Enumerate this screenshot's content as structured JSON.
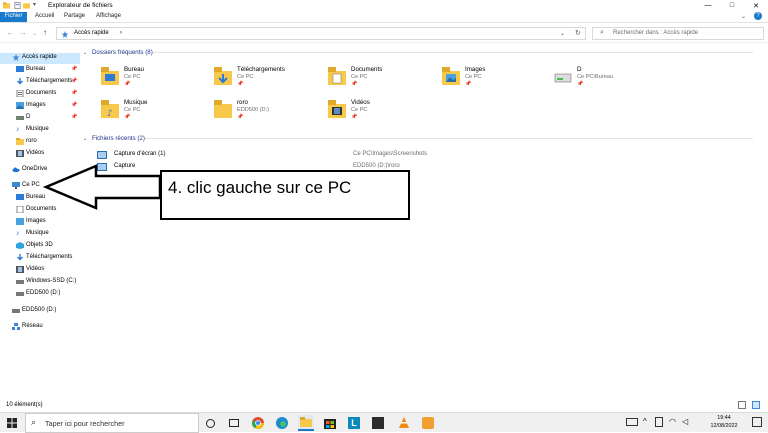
{
  "window": {
    "title": "Explorateur de fichiers",
    "controls": {
      "minimize": "—",
      "maximize": "□",
      "close": "✕"
    }
  },
  "ribbon": {
    "tabs": [
      "Fichier",
      "Accueil",
      "Partage",
      "Affichage"
    ],
    "active_color": "#1979ca"
  },
  "address_bar": {
    "crumb": "Accès rapide",
    "search_placeholder": "Rechercher dans : Accès rapide"
  },
  "sidebar": {
    "quick_access": "Accès rapide",
    "quick_items": [
      "Bureau",
      "Téléchargements",
      "Documents",
      "Images",
      "D",
      "Musique",
      "roro",
      "Vidéos"
    ],
    "onedrive": "OneDrive",
    "this_pc": "Ce PC",
    "pc_items": [
      "Bureau",
      "Documents",
      "Images",
      "Musique",
      "Objets 3D",
      "Téléchargements",
      "Vidéos",
      "Windows-SSD (C:)",
      "EDD500 (D:)"
    ],
    "drive": "EDD500 (D:)",
    "network": "Réseau"
  },
  "frequent": {
    "header": "Dossiers fréquents (8)",
    "tiles": [
      {
        "name": "Bureau",
        "sub": "Ce PC",
        "icon": "desktop-folder-icon"
      },
      {
        "name": "Téléchargements",
        "sub": "Ce PC",
        "icon": "downloads-folder-icon"
      },
      {
        "name": "Documents",
        "sub": "Ce PC",
        "icon": "documents-folder-icon"
      },
      {
        "name": "Images",
        "sub": "Ce PC",
        "icon": "pictures-folder-icon"
      },
      {
        "name": "D",
        "sub": "Ce PC\\Bureau",
        "icon": "drive-folder-icon"
      },
      {
        "name": "Musique",
        "sub": "Ce PC",
        "icon": "music-folder-icon"
      },
      {
        "name": "roro",
        "sub": "EDD500 (D:)",
        "icon": "folder-icon"
      },
      {
        "name": "Vidéos",
        "sub": "Ce PC",
        "icon": "videos-folder-icon"
      }
    ]
  },
  "recent": {
    "header": "Fichiers récents (2)",
    "rows": [
      {
        "name": "Capture d'écran (1)",
        "location": "Ce PC\\Images\\Screenshots"
      },
      {
        "name": "Capture",
        "location": "EDD500 (D:)\\roro"
      }
    ]
  },
  "annotation": {
    "text": "4. clic gauche sur ce PC"
  },
  "status": {
    "count": "10 élément(s)"
  },
  "taskbar": {
    "search_placeholder": "Taper ici pour rechercher",
    "time": "19:44",
    "date": "12/08/2022"
  }
}
